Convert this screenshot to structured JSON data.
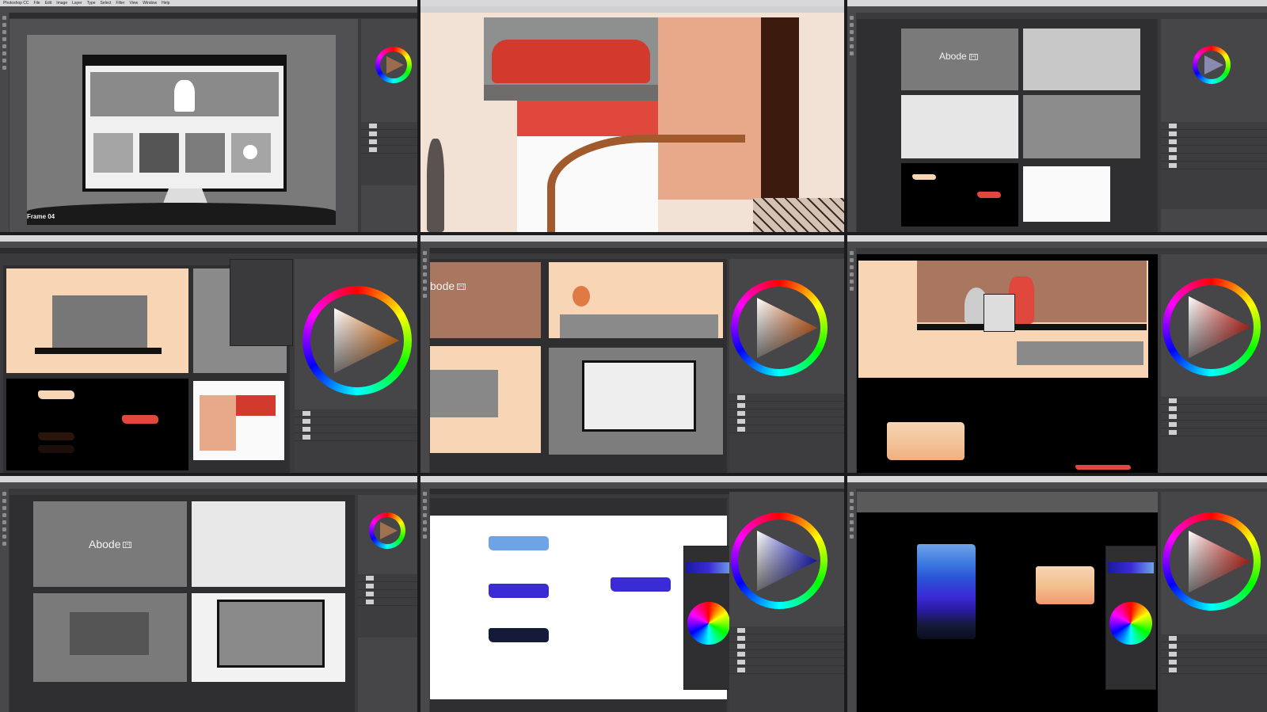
{
  "menu": [
    "Photoshop CC",
    "File",
    "Edit",
    "Image",
    "Layer",
    "Type",
    "Select",
    "Filter",
    "3D",
    "View",
    "Window",
    "Help"
  ],
  "frame_label": "Frame 04",
  "brand_name": "Abode",
  "brand_name_cut": "bode",
  "brand_mark": "[=]",
  "colors": {
    "ui_dark": "#3a3a3c",
    "canvas_grey": "#525254",
    "peach": "#f7d5b5",
    "terracotta": "#a9775f",
    "red": "#e0473d",
    "blue_light": "#6fa3e8",
    "blue_mid": "#3a2bd6",
    "navy": "#141a38",
    "black": "#000000"
  },
  "icons": [
    "move-tool-icon",
    "marquee-tool-icon",
    "lasso-tool-icon",
    "brush-tool-icon",
    "eraser-tool-icon",
    "text-tool-icon",
    "hand-tool-icon",
    "zoom-tool-icon"
  ]
}
